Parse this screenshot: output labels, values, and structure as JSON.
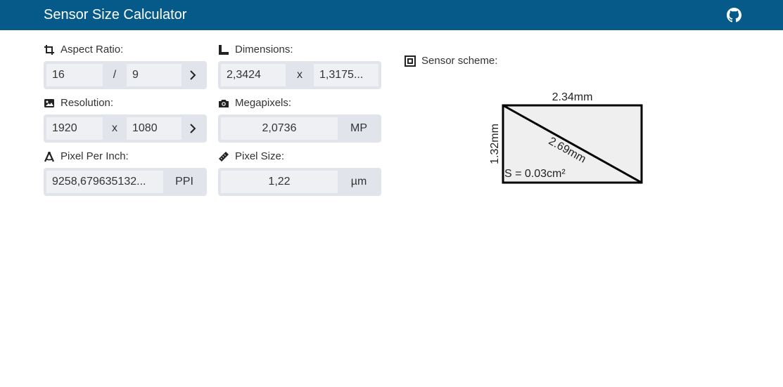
{
  "header": {
    "title": "Sensor Size Calculator",
    "github_icon": "github-icon",
    "bar_color": "#065a8a"
  },
  "aspect_ratio": {
    "label": "Aspect Ratio:",
    "width": "16",
    "separator": "/",
    "height": "9",
    "icon": "crop-icon"
  },
  "dimensions": {
    "label": "Dimensions:",
    "width": "2,3424",
    "separator": "x",
    "height": "1,3175...",
    "icon": "ruler-corner-icon"
  },
  "resolution": {
    "label": "Resolution:",
    "width": "1920",
    "separator": "x",
    "height": "1080",
    "icon": "image-icon"
  },
  "megapixels": {
    "label": "Megapixels:",
    "value": "2,0736",
    "unit": "MP",
    "icon": "camera-icon"
  },
  "ppi": {
    "label": "Pixel Per Inch:",
    "value": "9258,679635132...",
    "unit": "PPI",
    "icon": "compass-drafting-icon"
  },
  "pixel_size": {
    "label": "Pixel Size:",
    "value": "1,22",
    "unit": "µm",
    "icon": "ruler-icon"
  },
  "scheme": {
    "label": "Sensor scheme:",
    "icon": "sensor-frame-icon",
    "width_label": "2.34mm",
    "height_label": "1.32mm",
    "diagonal_label": "2.69mm",
    "area_label": "S = 0.03cm²"
  },
  "colors": {
    "field_group": "#e1e5eb",
    "field": "#eef0f4",
    "sensor_fill": "#efefef"
  }
}
